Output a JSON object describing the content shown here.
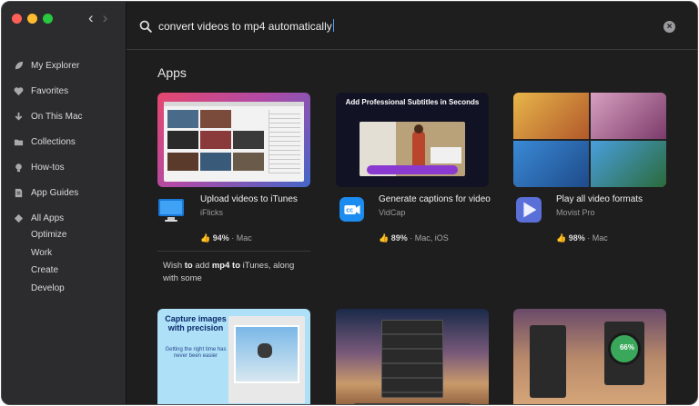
{
  "sidebar": {
    "items": [
      {
        "label": "My Explorer",
        "icon": "leaf-icon"
      },
      {
        "label": "Favorites",
        "icon": "heart-icon"
      },
      {
        "label": "On This Mac",
        "icon": "download-arrow-icon"
      },
      {
        "label": "Collections",
        "icon": "folder-icon"
      },
      {
        "label": "How-tos",
        "icon": "lightbulb-icon"
      },
      {
        "label": "App Guides",
        "icon": "document-icon"
      },
      {
        "label": "All Apps",
        "icon": "diamond-icon"
      }
    ],
    "subitems": [
      "Optimize",
      "Work",
      "Create",
      "Develop"
    ]
  },
  "search": {
    "query": "convert videos to mp4 automatically"
  },
  "section": {
    "title": "Apps"
  },
  "cards": [
    {
      "title": "Upload videos to iTunes",
      "developer": "iFlicks",
      "rating": "94%",
      "platforms": " · Mac",
      "icon": "monitor-icon"
    },
    {
      "title": "Generate captions for video",
      "developer": "VidCap",
      "rating": "89%",
      "platforms": " · Mac, iOS",
      "icon": "cc-camera-icon",
      "thumb_text": "Add Professional Subtitles in Seconds"
    },
    {
      "title": "Play all video formats",
      "developer": "Movist Pro",
      "rating": "98%",
      "platforms": " · Mac",
      "icon": "play-triangle-icon"
    }
  ],
  "snippet": {
    "part1": "Wish ",
    "bold1": "to",
    "part2": " add ",
    "bold2": "mp4",
    "part3": " ",
    "bold3": "to",
    "part4": " iTunes, along with some"
  },
  "row2": [
    {
      "thumb_text": "Capture images with precision",
      "thumb_sub": "Getting the right time has never been easier"
    },
    {},
    {
      "thumb_text": "66%"
    }
  ],
  "colors": {
    "accent": "#4da3ff",
    "sidebar_bg": "#2c2c2e",
    "main_bg": "#1e1e1f"
  }
}
